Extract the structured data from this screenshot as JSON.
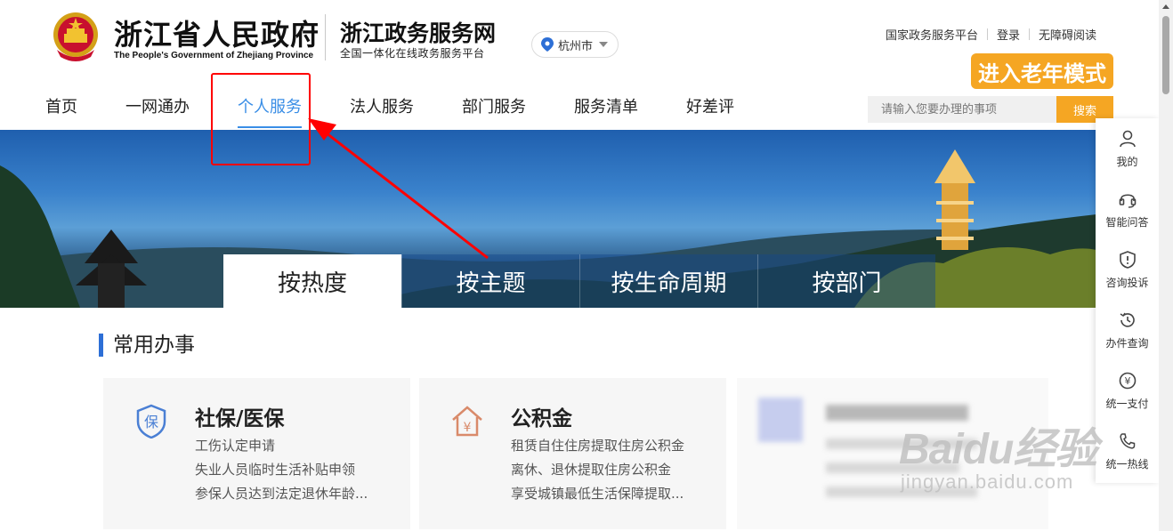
{
  "header": {
    "gov_title": "浙江省人民政府",
    "gov_subtitle": "The People's Government of Zhejiang Province",
    "portal_title": "浙江政务服务网",
    "portal_subtitle": "全国一体化在线政务服务平台",
    "city": "杭州市",
    "top_links": [
      "国家政务服务平台",
      "登录",
      "无障碍阅读"
    ],
    "elder_mode": "进入老年模式"
  },
  "nav": {
    "items": [
      "首页",
      "一网通办",
      "个人服务",
      "法人服务",
      "部门服务",
      "服务清单",
      "好差评"
    ],
    "active": "个人服务"
  },
  "search": {
    "placeholder": "请输入您要办理的事项",
    "button": "搜索"
  },
  "banner": {
    "tabs": [
      "按热度",
      "按主题",
      "按生命周期",
      "按部门"
    ],
    "active_tab": "按热度"
  },
  "section": {
    "title": "常用办事"
  },
  "cards": [
    {
      "icon": "shield-bao-icon",
      "title": "社保/医保",
      "lines": [
        "工伤认定申请",
        "失业人员临时生活补贴申领",
        "参保人员达到法定退休年龄..."
      ]
    },
    {
      "icon": "house-yuan-icon",
      "title": "公积金",
      "lines": [
        "租赁自住住房提取住房公积金",
        "离休、退休提取住房公积金",
        "享受城镇最低生活保障提取..."
      ]
    }
  ],
  "sidebar": {
    "items": [
      {
        "label": "我的",
        "icon": "user-icon"
      },
      {
        "label": "智能问答",
        "icon": "headset-icon"
      },
      {
        "label": "咨询投诉",
        "icon": "alert-shield-icon"
      },
      {
        "label": "办件查询",
        "icon": "history-icon"
      },
      {
        "label": "统一支付",
        "icon": "yuan-circle-icon"
      },
      {
        "label": "统一热线",
        "icon": "phone-icon"
      }
    ]
  },
  "watermark": {
    "brand": "Baidu经验",
    "url": "jingyan.baidu.com"
  },
  "colors": {
    "accent_blue": "#3a8ee6",
    "orange": "#f5a623",
    "annotation_red": "#ff0000",
    "section_bar": "#2d6fd6"
  }
}
